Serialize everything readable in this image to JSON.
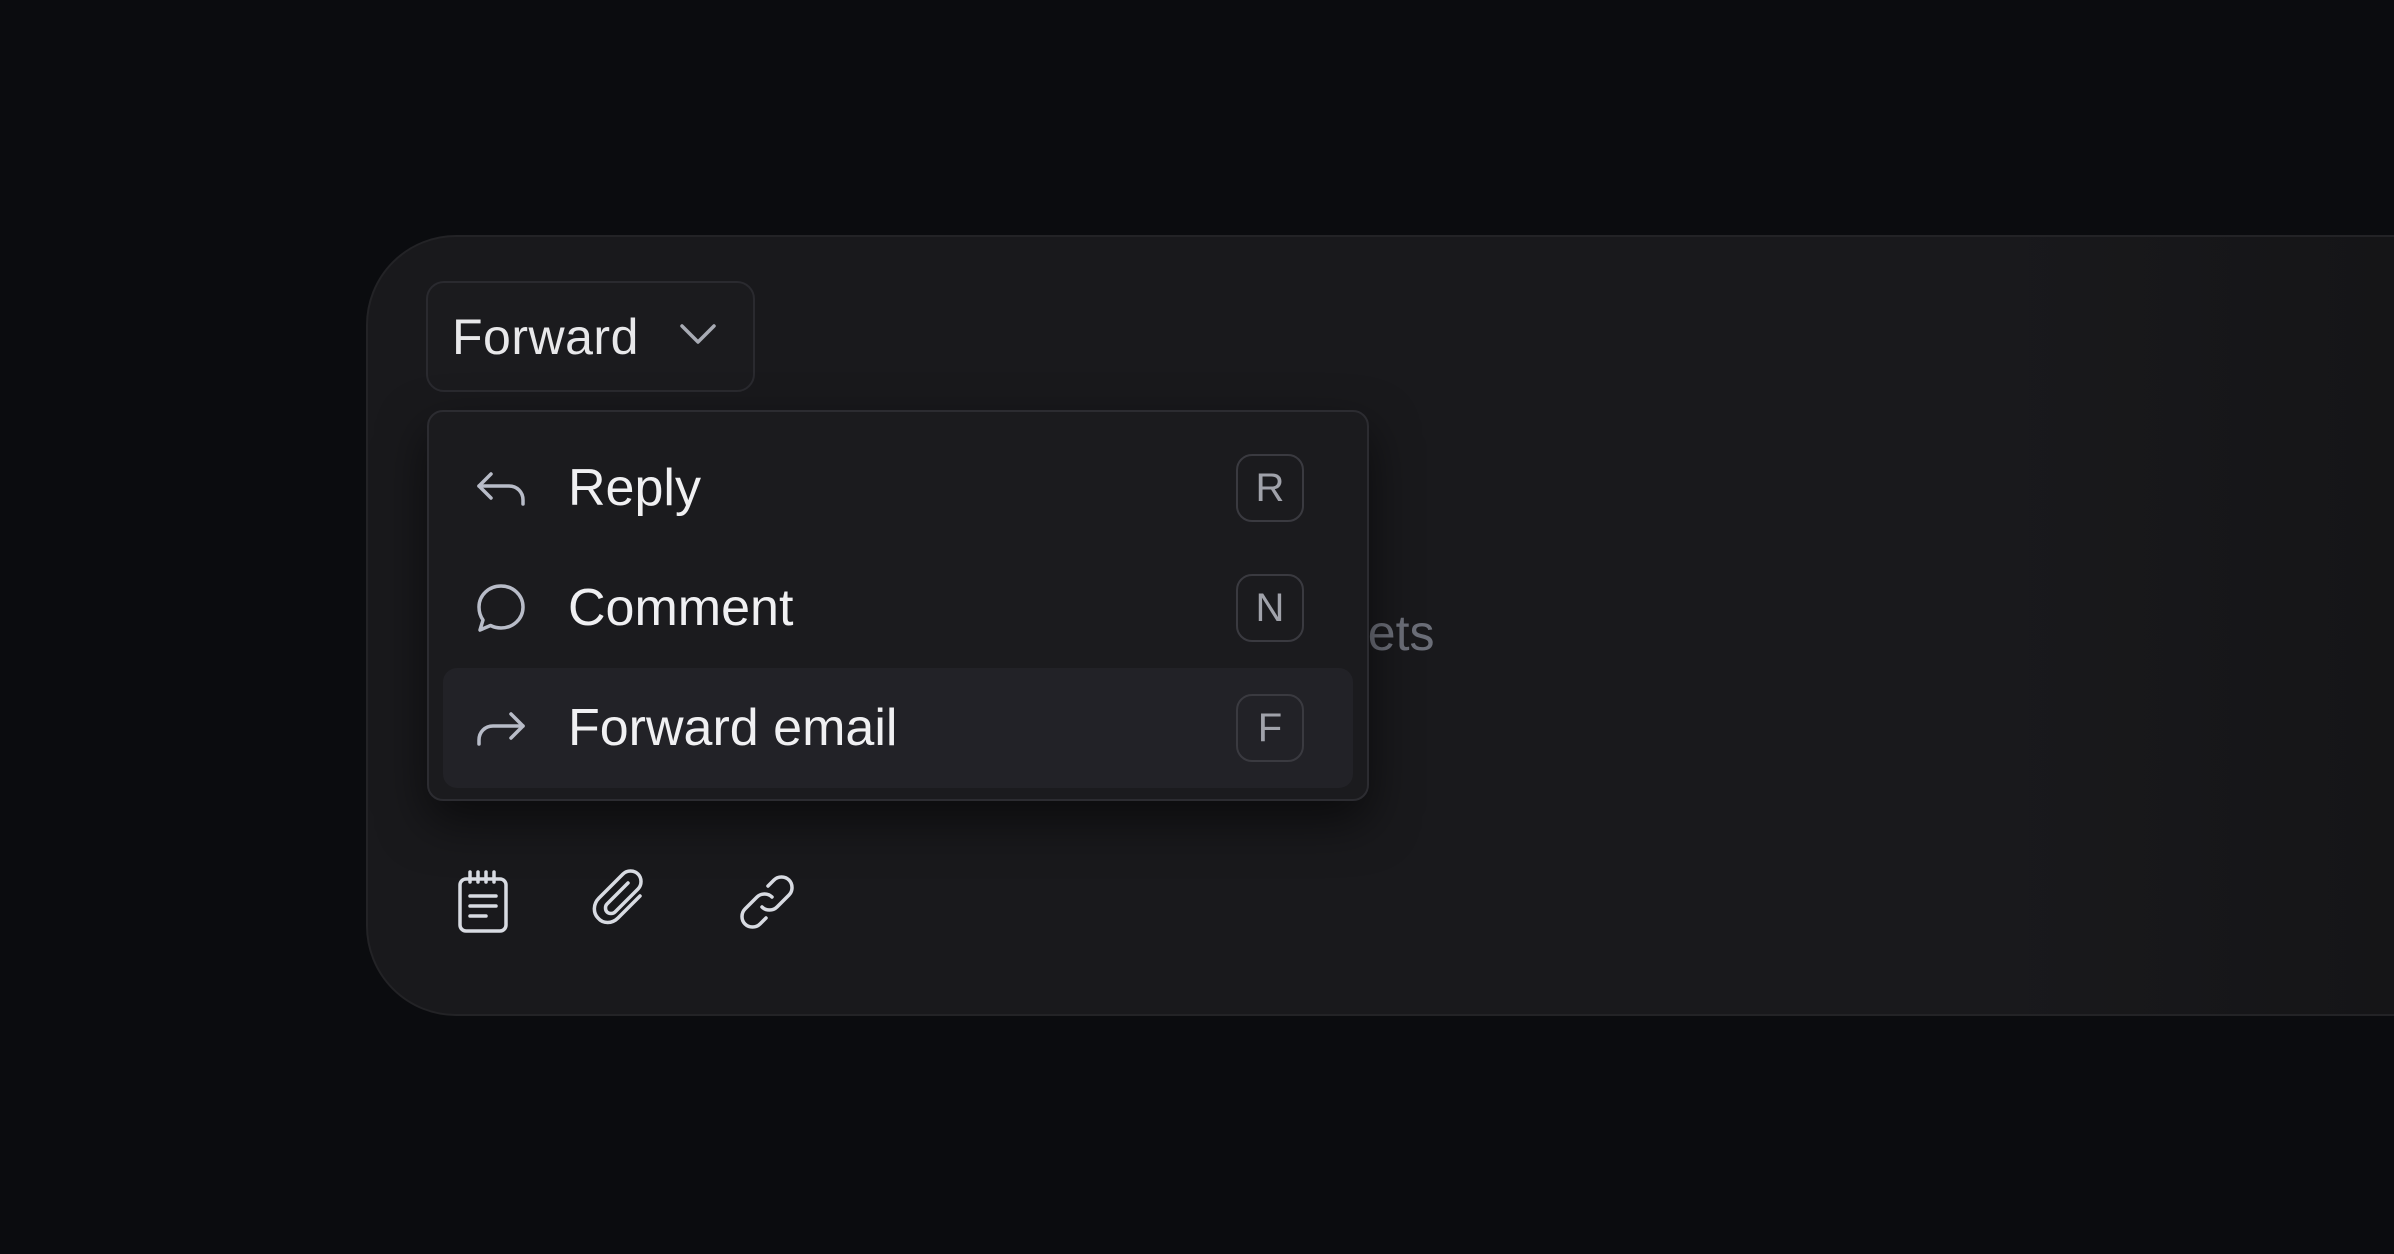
{
  "composer": {
    "mode_select": {
      "label": "Forward",
      "icon": "chevron-down-icon"
    },
    "placeholder_fragment": "pets"
  },
  "menu": {
    "items": [
      {
        "label": "Reply",
        "shortcut": "R",
        "icon": "reply-arrow-icon",
        "active": false
      },
      {
        "label": "Comment",
        "shortcut": "N",
        "icon": "comment-bubble-icon",
        "active": false
      },
      {
        "label": "Forward email",
        "shortcut": "F",
        "icon": "forward-arrow-icon",
        "active": true
      }
    ]
  },
  "toolbar": {
    "tools": [
      {
        "name": "notes",
        "icon": "notepad-icon"
      },
      {
        "name": "attach",
        "icon": "paperclip-icon"
      },
      {
        "name": "link",
        "icon": "link-icon"
      }
    ]
  },
  "colors": {
    "page_background": "#0b0c0f",
    "panel_background": "#19191c",
    "menu_background": "#1b1b1e",
    "menu_item_active": "#222227",
    "text_primary": "#f0f0f2",
    "text_placeholder": "#6b6e78",
    "icon_stroke": "#b8bcc8"
  }
}
